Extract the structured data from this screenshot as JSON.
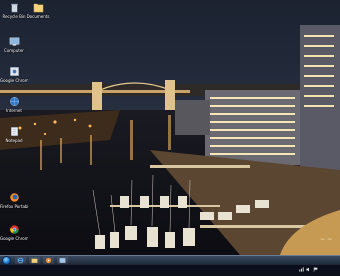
{
  "desktop_icons": [
    {
      "label": "Recycle Bin",
      "icon": "recycle-bin-icon"
    },
    {
      "label": "Documents",
      "icon": "folder-icon"
    },
    {
      "label": "Computer",
      "icon": "computer-icon"
    },
    {
      "label": "Google Chrome",
      "icon": "chrome-icon"
    },
    {
      "label": "Internet",
      "icon": "globe-icon"
    },
    {
      "label": "Notepad",
      "icon": "notepad-icon"
    },
    {
      "label": "Firefox Portable",
      "icon": "firefox-icon"
    },
    {
      "label": "Google Chrome",
      "icon": "chrome-icon"
    }
  ],
  "taskbar": {
    "pinned": [
      {
        "icon": "internet-explorer-icon"
      },
      {
        "icon": "folder-icon"
      },
      {
        "icon": "media-player-icon"
      },
      {
        "icon": "window-icon"
      }
    ],
    "clock_time": "",
    "clock_date": ""
  },
  "colors": {
    "taskbar_top": "#3b4b63",
    "taskbar_bottom": "#1c2634",
    "start_orb": "#1a6fc4"
  }
}
